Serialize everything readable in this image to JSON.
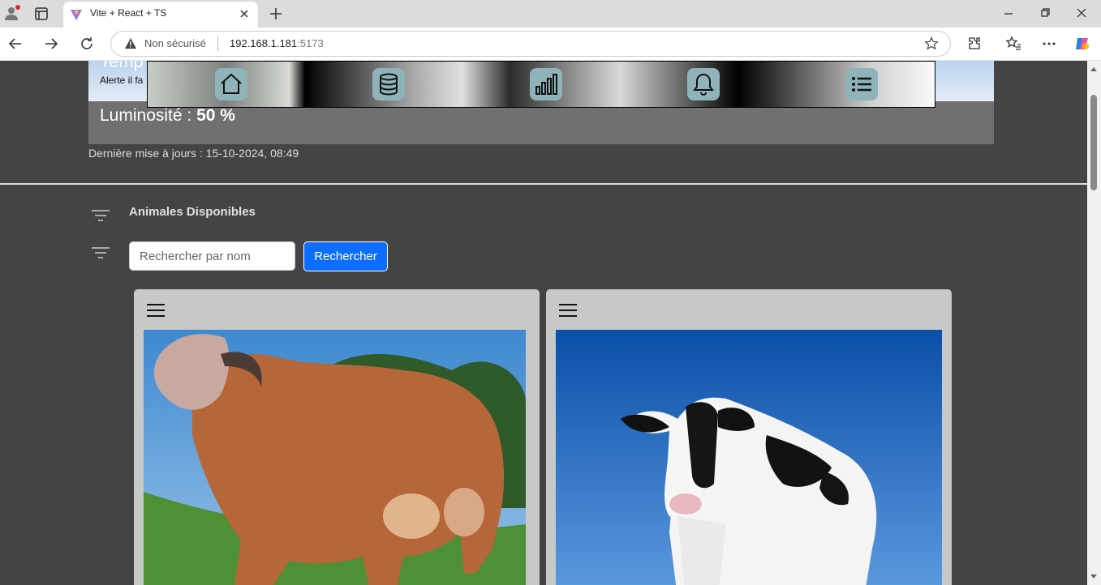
{
  "browser": {
    "tab_title": "Vite + React + TS",
    "security_label": "Non sécurisé",
    "url_host": "192.168.1.181",
    "url_port": ":5173"
  },
  "header": {
    "title_fragment": "Temp",
    "alert_fragment": "Alerte il fa"
  },
  "navbar": {
    "items": [
      "home-icon",
      "database-icon",
      "chart-icon",
      "bell-icon",
      "list-icon"
    ],
    "button_color": "#8fb3b8"
  },
  "luminosity": {
    "label": "Luminosité : ",
    "value": "50 %"
  },
  "last_update": "Dernière mise à jours : 15-10-2024, 08:49",
  "section": {
    "title": "Animales Disponibles",
    "search_placeholder": "Rechercher par nom",
    "search_button": "Rechercher"
  },
  "cards": [
    {
      "image": "brown-zebu-cow",
      "menu_icon": "hamburger-icon"
    },
    {
      "image": "holstein-cow",
      "menu_icon": "hamburger-icon"
    }
  ],
  "colors": {
    "page_bg": "#444444",
    "accent": "#0d6efd",
    "card_bg": "#c8c8c8"
  }
}
